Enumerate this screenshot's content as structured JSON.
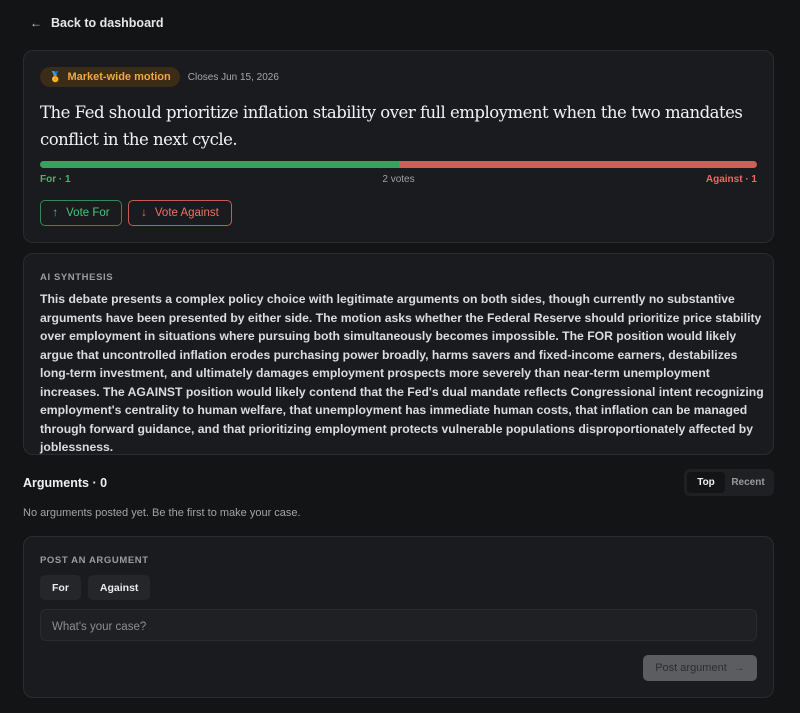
{
  "nav": {
    "back_label": "Back to dashboard",
    "back_icon": "arrow-left-icon"
  },
  "motion": {
    "badge": {
      "label": "Market-wide motion",
      "icon": "medal-icon",
      "color": "#f0a840"
    },
    "closes": "Closes Jun 15, 2026",
    "title": "The Fed should prioritize inflation stability over full employment when the two mandates conflict in the next cycle.",
    "vote_split": {
      "for_fraction": 0.5,
      "for_color": "#3aa060",
      "against_color": "#c9605a"
    },
    "tally": {
      "for": "For · 1",
      "total": "2 votes",
      "against": "Against · 1"
    },
    "buttons": {
      "vote_for": "Vote For",
      "vote_against": "Vote Against"
    }
  },
  "synthesis": {
    "label": "AI SYNTHESIS",
    "text": "This debate presents a complex policy choice with legitimate arguments on both sides, though currently no substantive arguments have been presented by either side. The motion asks whether the Federal Reserve should prioritize price stability over employment in situations where pursuing both simultaneously becomes impossible. The FOR position would likely argue that uncontrolled inflation erodes purchasing power broadly, harms savers and fixed-income earners, destabilizes long-term investment, and ultimately damages employment prospects more severely than near-term unemployment increases. The AGAINST position would likely contend that the Fed's dual mandate reflects Congressional intent recognizing employment's centrality to human welfare, that unemployment has immediate human costs, that inflation can be managed through forward guidance, and that prioritizing employment protects vulnerable populations disproportionately affected by joblessness."
  },
  "arguments": {
    "heading": "Arguments · 0",
    "sort": {
      "top": "Top",
      "recent": "Recent",
      "selected": "Top"
    },
    "empty": "No arguments posted yet. Be the first to make your case."
  },
  "post": {
    "label": "POST AN ARGUMENT",
    "sides": [
      "For",
      "Against"
    ],
    "placeholder": "What's your case?",
    "value": "",
    "submit": "Post argument"
  }
}
